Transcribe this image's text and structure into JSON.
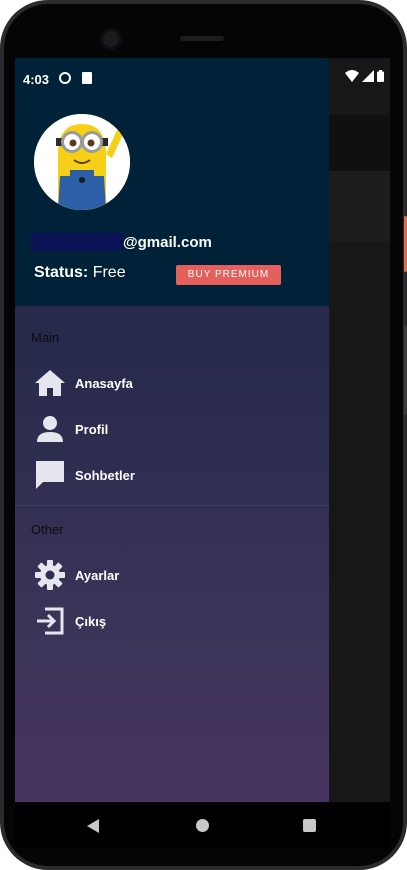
{
  "statusbar": {
    "time": "4:03"
  },
  "header": {
    "email_domain": "@gmail.com",
    "status_label": "Status:",
    "status_value": "Free",
    "premium_button": "BUY PREMIUM"
  },
  "sections": {
    "main_title": "Main",
    "other_title": "Other"
  },
  "menu": {
    "home": {
      "label": "Anasayfa",
      "icon": "home-icon"
    },
    "profile": {
      "label": "Profil",
      "icon": "person-icon"
    },
    "chats": {
      "label": "Sohbetler",
      "icon": "chat-icon"
    },
    "settings": {
      "label": "Ayarlar",
      "icon": "gear-icon"
    },
    "logout": {
      "label": "Çıkış",
      "icon": "logout-icon"
    }
  },
  "colors": {
    "header_bg": "#002239",
    "premium_button": "#e55f5c",
    "icon": "#e6e6ee"
  }
}
